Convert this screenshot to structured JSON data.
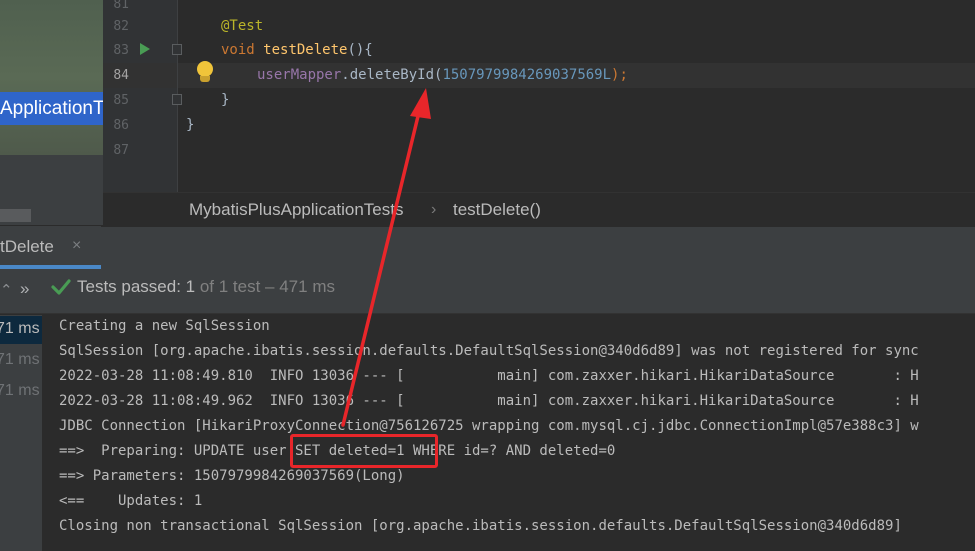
{
  "project_panel": {
    "thumbnail_label": "ApplicationTe"
  },
  "editor": {
    "lines": [
      {
        "number": "81",
        "text": ""
      },
      {
        "number": "82",
        "text": "@Test"
      },
      {
        "number": "83",
        "text": "void testDelete(){"
      },
      {
        "number": "84",
        "text": "userMapper.deleteById(1507979984269037569L);"
      },
      {
        "number": "85",
        "text": "}"
      },
      {
        "number": "86",
        "text": "}"
      },
      {
        "number": "87",
        "text": ""
      }
    ],
    "code": {
      "annotation": "@Test",
      "void_kw": "void",
      "method_name": "testDelete",
      "method_sig_tail": "(){",
      "field": "userMapper",
      "call": ".deleteById(",
      "number_literal": "1507979984269037569L",
      "call_close": ");",
      "brace_close_inner": "}",
      "brace_close_outer": "}"
    }
  },
  "breadcrumb": {
    "class_name": "MybatisPlusApplicationTests",
    "separator": "›",
    "method_name": "testDelete()"
  },
  "run_window": {
    "tab_label": "tDelete",
    "tab_close": "×",
    "toolbar_arrow_left": "⌃",
    "toolbar_arrow_expand": "»",
    "status_passed": "Tests passed: 1",
    "status_detail": " of 1 test – 471 ms",
    "tree_times": [
      "71 ms",
      "71 ms",
      "71 ms"
    ]
  },
  "console": {
    "lines": [
      "Creating a new SqlSession",
      "SqlSession [org.apache.ibatis.session.defaults.DefaultSqlSession@340d6d89] was not registered for sync",
      "2022-03-28 11:08:49.810  INFO 13036 --- [           main] com.zaxxer.hikari.HikariDataSource       : H",
      "2022-03-28 11:08:49.962  INFO 13036 --- [           main] com.zaxxer.hikari.HikariDataSource       : H",
      "JDBC Connection [HikariProxyConnection@756126725 wrapping com.mysql.cj.jdbc.ConnectionImpl@57e388c3] w",
      "==>  Preparing: UPDATE user SET deleted=1 WHERE id=? AND deleted=0",
      "==> Parameters: 1507979984269037569(Long)",
      "<==    Updates: 1",
      "Closing non transactional SqlSession [org.apache.ibatis.session.defaults.DefaultSqlSession@340d6d89]"
    ]
  },
  "colors": {
    "annotation_red": "#e8262a",
    "check_green": "#499c54",
    "selection_blue": "#2f65ca"
  }
}
